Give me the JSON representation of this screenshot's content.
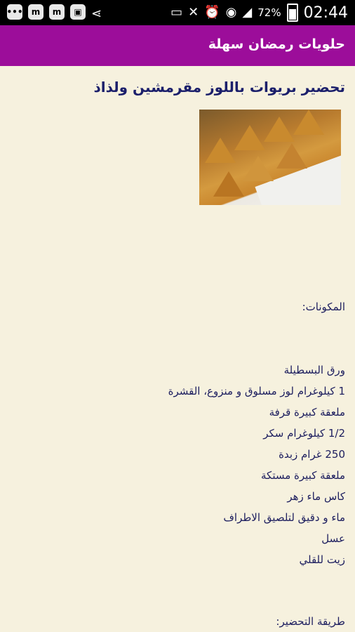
{
  "status_bar": {
    "left_icons": [
      "notification-icon",
      "messenger-icon",
      "messenger-icon",
      "bag-icon",
      "share-icon"
    ],
    "battery": "72%",
    "time": "02:44"
  },
  "app_bar": {
    "title": "حلويات رمضان سهلة"
  },
  "article": {
    "title": "تحضير بريوات باللوز مقرمشين ولذاذ",
    "ingredients_label": "المكونات:",
    "ingredients": [
      "ورق البسطيلة",
      "1 كيلوغرام لوز مسلوق و منزوع، القشرة",
      "ملعقة كبيرة قرفة",
      "1/2 كيلوغرام سكر",
      "250 غرام زبدة",
      "ملعقة كبيرة مستكة",
      "كاس ماء زهر",
      "ماء و دقيق لتلصيق الاطراف",
      "عسل",
      "زيت للقلي"
    ],
    "method_label": "طريقة التحضير:"
  }
}
